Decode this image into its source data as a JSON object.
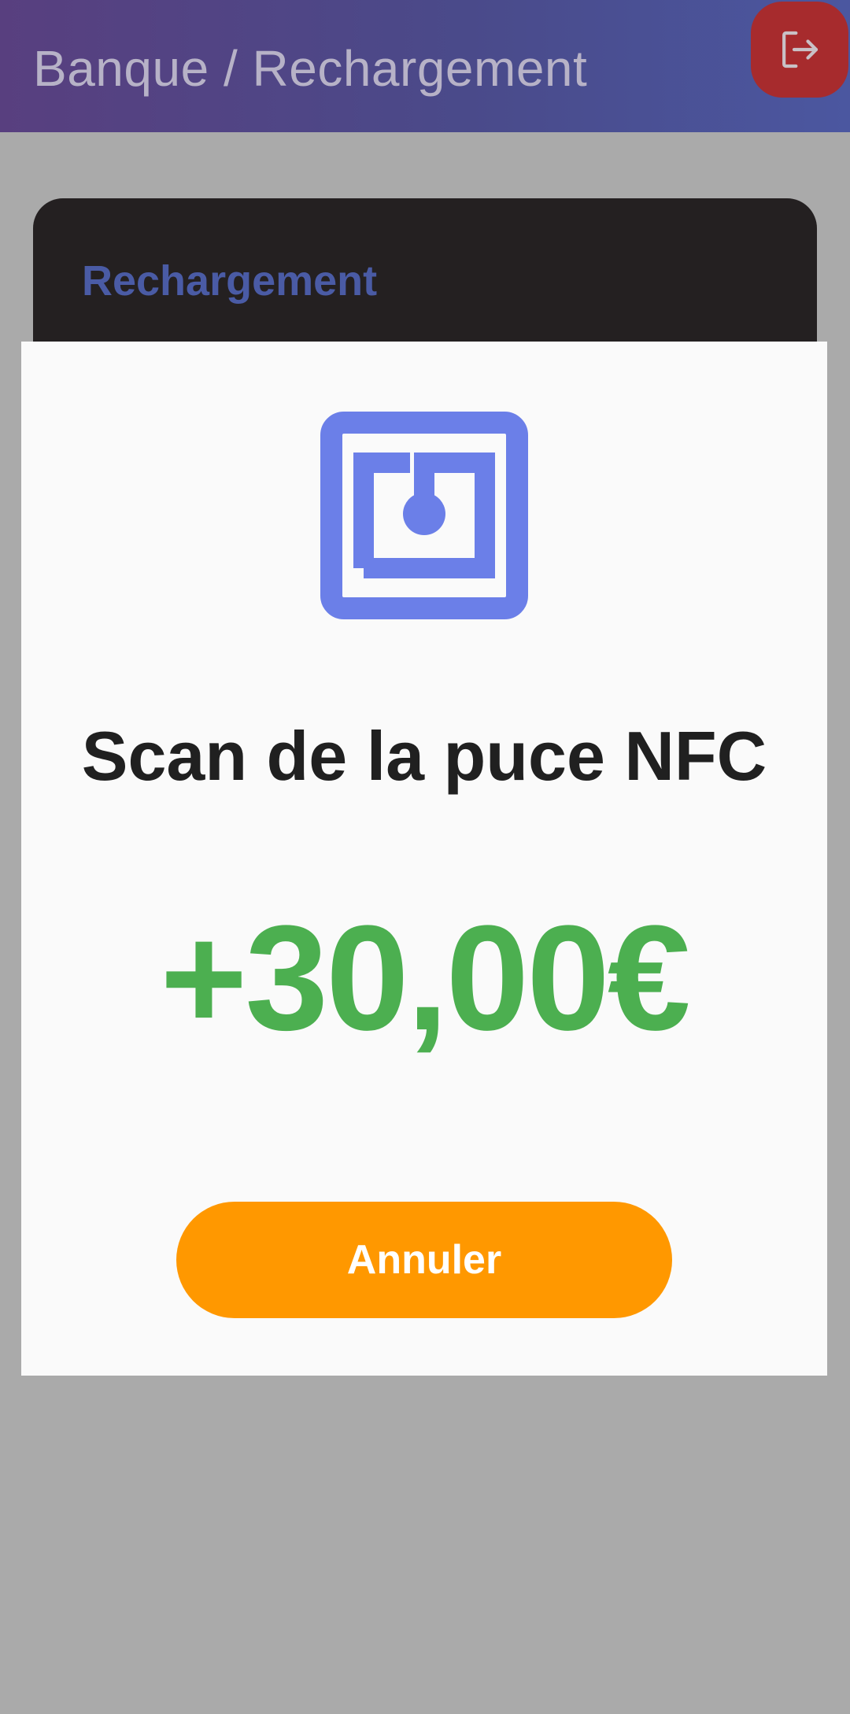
{
  "app_bar": {
    "title": "Banque / Rechargement",
    "logout_icon": "logout-icon",
    "accent_color": "#a72b2d"
  },
  "card": {
    "title": "Rechargement"
  },
  "dialog": {
    "icon": "nfc-icon",
    "icon_color": "#6b7fe8",
    "title": "Scan de la puce NFC",
    "amount": "+30,00€",
    "amount_color": "#4caf50",
    "cancel_label": "Annuler",
    "cancel_color": "#ff9800"
  }
}
